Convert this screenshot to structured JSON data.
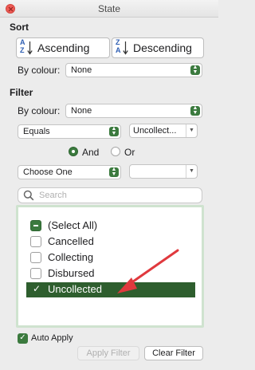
{
  "window": {
    "title": "State"
  },
  "sort": {
    "heading": "Sort",
    "ascending_label": "Ascending",
    "descending_label": "Descending",
    "by_colour_label": "By colour:",
    "by_colour_value": "None"
  },
  "filter": {
    "heading": "Filter",
    "by_colour_label": "By colour:",
    "by_colour_value": "None",
    "condition1": {
      "operator": "Equals",
      "value": "Uncollect..."
    },
    "logic": {
      "and_label": "And",
      "or_label": "Or",
      "selected": "And"
    },
    "condition2": {
      "operator": "Choose One",
      "value": ""
    }
  },
  "search": {
    "placeholder": "Search"
  },
  "list": {
    "items": [
      {
        "label": "(Select All)",
        "state": "mixed"
      },
      {
        "label": "Cancelled",
        "state": "unchecked"
      },
      {
        "label": "Collecting",
        "state": "unchecked"
      },
      {
        "label": "Disbursed",
        "state": "unchecked"
      },
      {
        "label": "Uncollected",
        "state": "checked",
        "selected": true
      }
    ]
  },
  "footer": {
    "auto_apply_label": "Auto Apply",
    "auto_apply_checked": true,
    "apply_filter_label": "Apply Filter",
    "clear_filter_label": "Clear Filter"
  },
  "colors": {
    "accent": "#3b7a3e",
    "selection": "#2e5e2e",
    "annotation_arrow": "#e0393e"
  }
}
